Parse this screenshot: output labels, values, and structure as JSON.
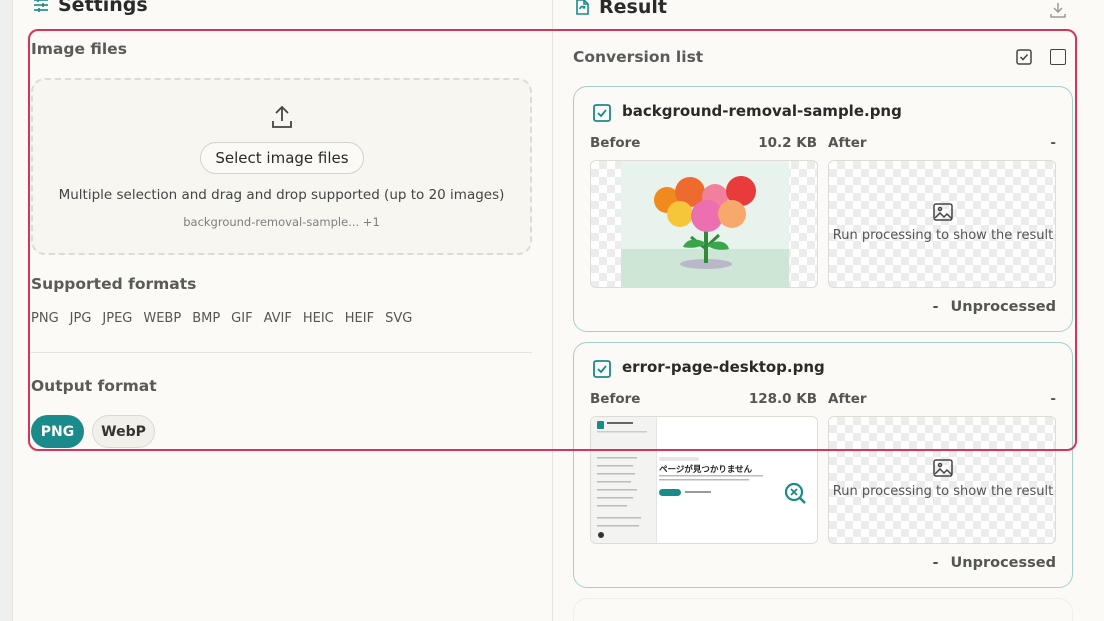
{
  "settings": {
    "title": "Settings",
    "image_files_label": "Image files",
    "select_button": "Select image files",
    "drop_help": "Multiple selection and drag and drop supported (up to 20 images)",
    "selected_files": "background-removal-sample... +1",
    "supported_label": "Supported formats",
    "formats": [
      "PNG",
      "JPG",
      "JPEG",
      "WEBP",
      "BMP",
      "GIF",
      "AVIF",
      "HEIC",
      "HEIF",
      "SVG"
    ],
    "output_label": "Output format",
    "output_options": [
      {
        "label": "PNG",
        "selected": true
      },
      {
        "label": "WebP",
        "selected": false
      }
    ]
  },
  "result": {
    "title": "Result",
    "list_title": "Conversion list",
    "items": [
      {
        "name": "background-removal-sample.png",
        "checked": true,
        "before_label": "Before",
        "before_size": "10.2 KB",
        "after_label": "After",
        "after_value": "-",
        "placeholder": "Run processing to show the result",
        "status_value": "-",
        "status": "Unprocessed"
      },
      {
        "name": "error-page-desktop.png",
        "checked": true,
        "before_label": "Before",
        "before_size": "128.0 KB",
        "after_label": "After",
        "after_value": "-",
        "placeholder": "Run processing to show the result",
        "status_value": "-",
        "status": "Unprocessed",
        "screenshot_heading": "ページが見つかりません"
      }
    ]
  },
  "colors": {
    "accent": "#1a8a8a",
    "highlight_border": "#d6345b",
    "card_border": "#a7cfc9"
  }
}
